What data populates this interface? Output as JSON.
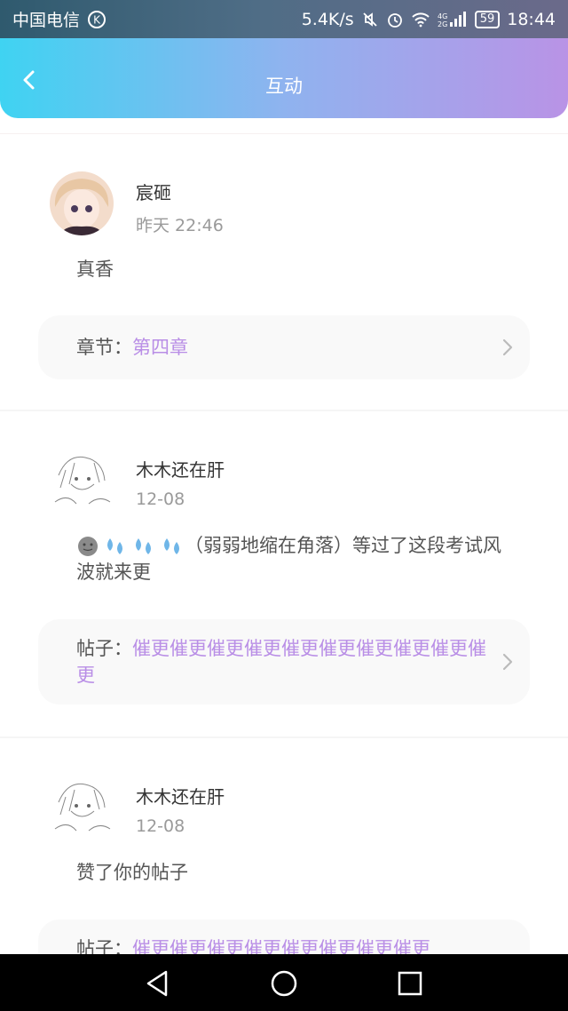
{
  "status_bar": {
    "carrier": "中国电信",
    "network_speed": "5.4K/s",
    "signal_label": "4G 2G",
    "battery": "59",
    "time": "18:44"
  },
  "header": {
    "title": "互动"
  },
  "items": [
    {
      "name": "宸砸",
      "time": "昨天 22:46",
      "message": "真香",
      "ref_label": "章节：",
      "ref_value": "第四章"
    },
    {
      "name": "木木还在肝",
      "time": "12-08",
      "message": "（弱弱地缩在角落）等过了这段考试风波就来更",
      "ref_label": "帖子：",
      "ref_value": "催更催更催更催更催更催更催更催更催更催更"
    },
    {
      "name": "木木还在肝",
      "time": "12-08",
      "message": "赞了你的帖子",
      "ref_label": "帖子：",
      "ref_value": "催更催更催更催更催更催更催更催更"
    }
  ],
  "colors": {
    "accent": "#b98ee6",
    "header_start": "#3fd3f2",
    "header_end": "#b993e6"
  }
}
